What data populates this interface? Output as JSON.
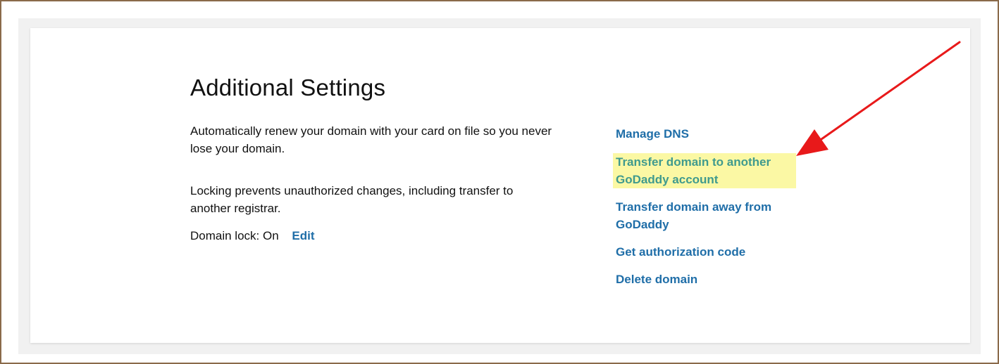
{
  "settings": {
    "title": "Additional Settings",
    "autorenew_text": "Automatically renew your domain with your card on file so you never lose your domain.",
    "locking_text": "Locking prevents unauthorized changes, including transfer to another registrar.",
    "domain_lock_label": "Domain lock:",
    "domain_lock_value": "On",
    "edit_label": "Edit"
  },
  "actions": {
    "manage_dns": "Manage DNS",
    "transfer_account": "Transfer domain to another GoDaddy account",
    "transfer_away": "Transfer domain away from GoDaddy",
    "auth_code": "Get authorization code",
    "delete_domain": "Delete domain"
  },
  "colors": {
    "link": "#1f6ea8",
    "highlight_bg": "#fbf8a4",
    "highlight_text": "#3f9a8e",
    "annotation_arrow": "#e8191a"
  },
  "annotation": {
    "icon": "arrow-icon"
  }
}
